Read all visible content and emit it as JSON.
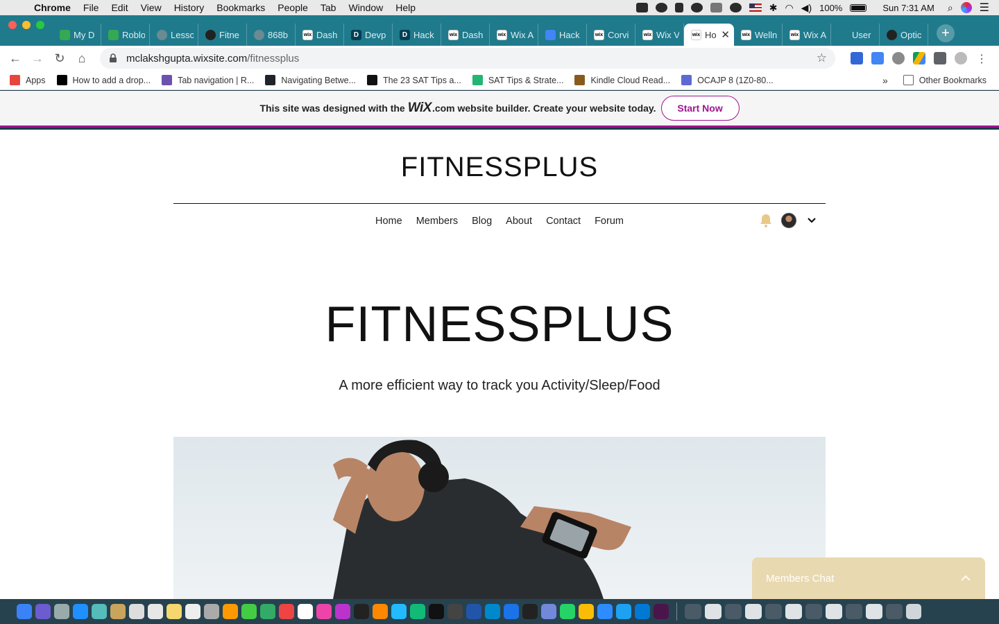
{
  "menubar": {
    "app_name": "Chrome",
    "menus": [
      "File",
      "Edit",
      "View",
      "History",
      "Bookmarks",
      "People",
      "Tab",
      "Window",
      "Help"
    ],
    "battery": "100%",
    "clock": "Sun 7:31 AM"
  },
  "tabs": [
    {
      "label": "My D",
      "favicon": "google-drive-icon",
      "color": "#34a853"
    },
    {
      "label": "Roblo",
      "favicon": "google-drive-icon",
      "color": "#34a853"
    },
    {
      "label": "Lessc",
      "favicon": "globe-icon",
      "color": "#6b8a92"
    },
    {
      "label": "Fitne",
      "favicon": "github-icon",
      "color": "#222222"
    },
    {
      "label": "868b",
      "favicon": "globe-icon",
      "color": "#6b8a92"
    },
    {
      "label": "Dash",
      "favicon": "wix-icon",
      "color": "#ffffff"
    },
    {
      "label": "Devp",
      "favicon": "devpost-icon",
      "color": "#003e54"
    },
    {
      "label": "Hack",
      "favicon": "devpost-icon",
      "color": "#003e54"
    },
    {
      "label": "Dash",
      "favicon": "wix-icon",
      "color": "#ffffff"
    },
    {
      "label": "Wix A",
      "favicon": "wix-icon",
      "color": "#ffffff"
    },
    {
      "label": "Hack",
      "favicon": "google-docs-icon",
      "color": "#4285f4"
    },
    {
      "label": "Corvi",
      "favicon": "wix-icon",
      "color": "#ffffff"
    },
    {
      "label": "Wix V",
      "favicon": "wix-icon",
      "color": "#ffffff"
    },
    {
      "label": "Ho",
      "favicon": "wix-icon",
      "color": "#ffffff",
      "active": true
    },
    {
      "label": "Welln",
      "favicon": "wix-icon",
      "color": "#ffffff"
    },
    {
      "label": "Wix A",
      "favicon": "wix-icon",
      "color": "#ffffff"
    },
    {
      "label": "User",
      "favicon": "blank-icon",
      "color": "#1f7a8c"
    },
    {
      "label": "Optic",
      "favicon": "github-icon",
      "color": "#222222"
    }
  ],
  "address": {
    "host": "mclakshgupta.wixsite.com",
    "path": "/fitnessplus"
  },
  "bookmarks": [
    {
      "label": "Apps",
      "icon": "apps-grid-icon",
      "color": "#e8453c"
    },
    {
      "label": "How to add a drop...",
      "icon": "medium-icon",
      "color": "#000000"
    },
    {
      "label": "Tab navigation | R...",
      "icon": "react-navigation-icon",
      "color": "#6b52ae"
    },
    {
      "label": "Navigating Betwe...",
      "icon": "react-icon",
      "color": "#20232a"
    },
    {
      "label": "The 23 SAT Tips a...",
      "icon": "graduation-cap-icon",
      "color": "#111111"
    },
    {
      "label": "SAT Tips & Strate...",
      "icon": "shield-check-icon",
      "color": "#22b573"
    },
    {
      "label": "Kindle Cloud Read...",
      "icon": "kindle-icon",
      "color": "#8a5a1c"
    },
    {
      "label": "OCAJP 8 (1Z0-80...",
      "icon": "java-icon",
      "color": "#5e6ad2"
    }
  ],
  "other_bookmarks": "Other Bookmarks",
  "wix_banner": {
    "text_before": "This site was designed with the",
    "logo": "WiX",
    "text_after": ".com website builder. Create your website today.",
    "cta": "Start Now",
    "accent": "#a0138e"
  },
  "site": {
    "title": "FITNESSPLUS",
    "nav": [
      "Home",
      "Members",
      "Blog",
      "About",
      "Contact",
      "Forum"
    ],
    "hero_title": "FITNESSPLUS",
    "hero_subtitle": "A more efficient way to track you Activity/Sleep/Food"
  },
  "chat": {
    "label": "Members Chat",
    "color": "#e9d9b0"
  }
}
